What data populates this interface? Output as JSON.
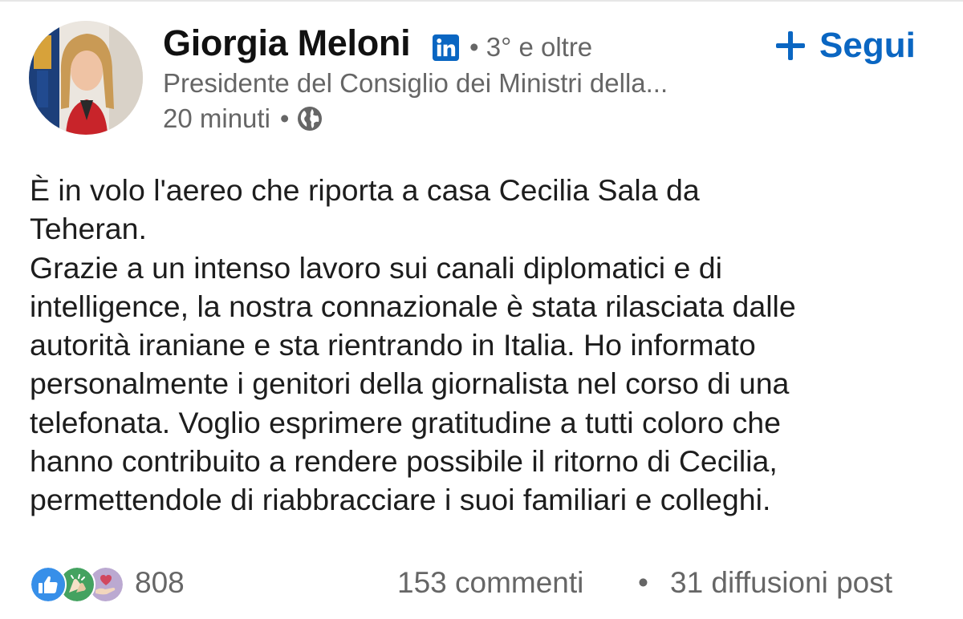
{
  "author": {
    "name": "Giorgia Meloni",
    "badge_icon": "linkedin-icon",
    "degree": "• 3° e oltre",
    "headline": "Presidente del Consiglio dei Ministri della...",
    "time": "20 minuti",
    "separator": "•",
    "visibility_icon": "globe-icon"
  },
  "follow": {
    "icon": "plus-icon",
    "label": "Segui",
    "color": "#0a66c2"
  },
  "post": {
    "lines": [
      "È in volo l'aereo che riporta a casa Cecilia Sala da",
      "Teheran.",
      "Grazie a un intenso lavoro sui canali diplomatici e di",
      "intelligence, la nostra connazionale è stata rilasciata dalle",
      "autorità iraniane e sta rientrando in Italia. Ho informato",
      "personalmente i genitori della giornalista nel corso di una",
      "telefonata. Voglio esprimere gratitudine a tutti coloro che",
      "hanno contribuito a rendere possibile il ritorno di Cecilia,",
      "permettendole di riabbracciare i suoi familiari e colleghi."
    ]
  },
  "social": {
    "reaction_icons": [
      "like-icon",
      "celebrate-icon",
      "support-icon"
    ],
    "reactions_count": "808",
    "comments": "153 commenti",
    "separator": "•",
    "reposts": "31 diffusioni post"
  }
}
